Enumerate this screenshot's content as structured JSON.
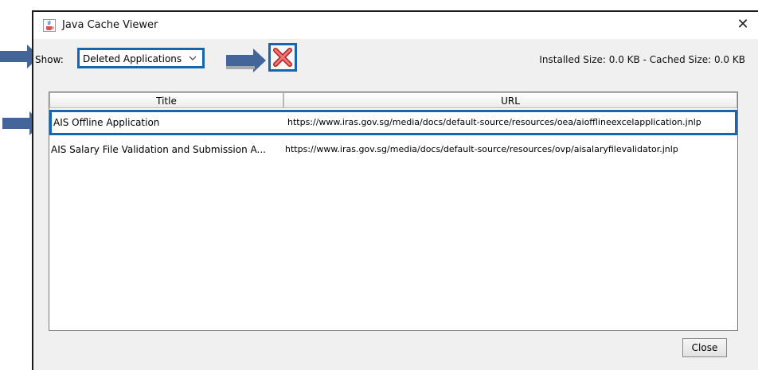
{
  "window": {
    "title": "Java Cache Viewer",
    "close_glyph": "✕"
  },
  "toolbar": {
    "show_label": "Show:",
    "show_selected": "Deleted Applications",
    "delete_icon": "red-x-icon",
    "installed_size": "Installed Size: 0.0 KB - Cached Size: 0.0 KB"
  },
  "table": {
    "headers": [
      "Title",
      "URL"
    ],
    "rows": [
      {
        "title": "AIS Offline Application",
        "url": "https://www.iras.gov.sg/media/docs/default-source/resources/oea/aiofflineexcelapplication.jnlp"
      },
      {
        "title": "AIS Salary File Validation and Submission A...",
        "url": "https://www.iras.gov.sg/media/docs/default-source/resources/ovp/aisalaryfilevalidator.jnlp"
      }
    ]
  },
  "footer": {
    "close_label": "Close"
  },
  "colors": {
    "highlight": "#1466b0",
    "arrow": "#44659a"
  }
}
